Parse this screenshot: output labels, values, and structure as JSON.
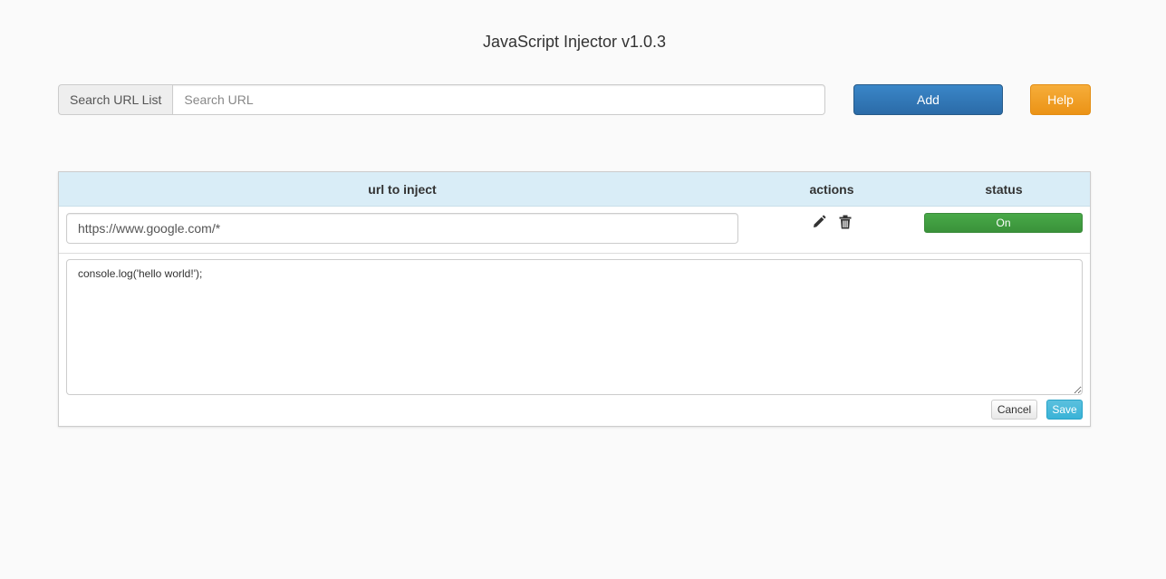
{
  "app": {
    "title": "JavaScript Injector v1.0.3"
  },
  "search": {
    "label": "Search URL List",
    "placeholder": "Search URL",
    "value": ""
  },
  "toolbar": {
    "add_label": "Add",
    "help_label": "Help"
  },
  "table": {
    "columns": {
      "url": "url to inject",
      "actions": "actions",
      "status": "status"
    },
    "rows": [
      {
        "url": "https://www.google.com/*",
        "status": "On",
        "script": "console.log('hello world!');",
        "edit_icon": "pencil-icon",
        "delete_icon": "trash-icon"
      }
    ]
  },
  "editor": {
    "cancel_label": "Cancel",
    "save_label": "Save"
  },
  "colors": {
    "primary": "#337ab7",
    "warning": "#f0ad4e",
    "success": "#449d44",
    "info": "#5bc0de",
    "header_bg": "#d9edf7"
  }
}
